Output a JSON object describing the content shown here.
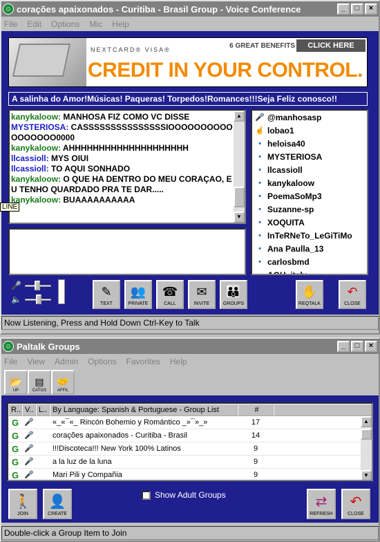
{
  "voice_window": {
    "title": "corações apaixonados - Curitiba - Brasil Group - Voice Conference",
    "menu": [
      "File",
      "Edit",
      "Options",
      "Mic",
      "Help"
    ],
    "banner": {
      "brand": "NEXTCARD® VISA®",
      "benefits": "6 GREAT BENEFITS",
      "cta": "CLICK HERE",
      "headline": "CREDIT IN YOUR CONTROL."
    },
    "topic": "A salinha do Amor!Músicas! Paqueras! Torpedos!Romances!!!Seja Feliz conosco!!",
    "chat": [
      {
        "user": "kanykaloow:",
        "text": " MANHOSA FIZ COMO VC DISSE",
        "color": "#1a7a1a"
      },
      {
        "user": "MYSTERIOSA:",
        "text": " CASSSSSSSSSSSSSSSIOOOOOOOOOOOOOOOOO0000",
        "color": "#1a1ac8"
      },
      {
        "user": "kanykaloow:",
        "text": " AHHHHHHHHHHHHHHHHHHHH",
        "color": "#1a7a1a"
      },
      {
        "user": "llcassioll:",
        "text": " MYS OIUI",
        "color": "#1a1ac8"
      },
      {
        "user": "llcassioll:",
        "text": " TO AQUI SONHADO",
        "color": "#1a1ac8"
      },
      {
        "user": "kanykaloow:",
        "text": " O QUE HA DENTRO DO MEU CORAÇAO, EU TENHO QUARDADO PRA TE DAR.....",
        "color": "#1a7a1a"
      },
      {
        "user": "kanykaloow:",
        "text": " BUAAAAAAAAAA",
        "color": "#1a7a1a"
      }
    ],
    "tooltip": "LINE",
    "users": [
      {
        "name": "@manhosasp",
        "icon": "mic-icon"
      },
      {
        "name": "lobao1",
        "icon": "hand-icon"
      },
      {
        "name": "heloisa40",
        "icon": "dot-icon"
      },
      {
        "name": "MYSTERIOSA",
        "icon": "dot-icon"
      },
      {
        "name": "llcassioll",
        "icon": "dot-icon"
      },
      {
        "name": "kanykaloow",
        "icon": "dot-icon"
      },
      {
        "name": "PoemaSoMp3",
        "icon": "dot-icon"
      },
      {
        "name": "Suzanne-sp",
        "icon": "dot-icon"
      },
      {
        "name": "XOQUITA",
        "icon": "dot-icon"
      },
      {
        "name": "InTeRNeTo_LeGiTiMo",
        "icon": "dot-icon"
      },
      {
        "name": "Ana Paulla_13",
        "icon": "dot-icon"
      },
      {
        "name": "carlosbmd",
        "icon": "dot-icon"
      },
      {
        "name": "AGH_italy",
        "icon": "dot-icon"
      }
    ],
    "toolbar": {
      "text": "TEXT",
      "private": "PRIVATE",
      "call": "CALL",
      "invite": "INVITE",
      "groups": "GROUPS",
      "reqtalk": "REQTALK",
      "close": "CLOSE"
    },
    "status": "Now Listening, Press and Hold Down Ctrl-Key to Talk"
  },
  "groups_window": {
    "title": "Paltalk Groups",
    "menu": [
      "File",
      "View",
      "Admin",
      "Options",
      "Favorites",
      "Help"
    ],
    "toolbar": {
      "up": "UP",
      "catgs": "CATGS",
      "affil": "AFFIL"
    },
    "columns": [
      "R..",
      "V..",
      "L..",
      "By Language: Spanish & Portuguese - Group List",
      "#"
    ],
    "rows": [
      {
        "r": "G",
        "name": "«_«¯«_ Rincón Bohemio y Romántico _»¯»_»",
        "count": "17"
      },
      {
        "r": "G",
        "name": "corações apaixonados - Curitiba - Brasil",
        "count": "14"
      },
      {
        "r": "G",
        "name": "!!!Discoteca!!! New York 100% Latinos",
        "count": "9"
      },
      {
        "r": "G",
        "name": "a la luz de la luna",
        "count": "9"
      },
      {
        "r": "G",
        "name": "Mari Pili y Compañia",
        "count": "9"
      }
    ],
    "buttons": {
      "join": "JOIN",
      "create": "CREATE",
      "refresh": "REFRESH",
      "close": "CLOSE"
    },
    "adult_label": "Show Adult Groups",
    "status": "Double-click a Group Item to Join"
  }
}
